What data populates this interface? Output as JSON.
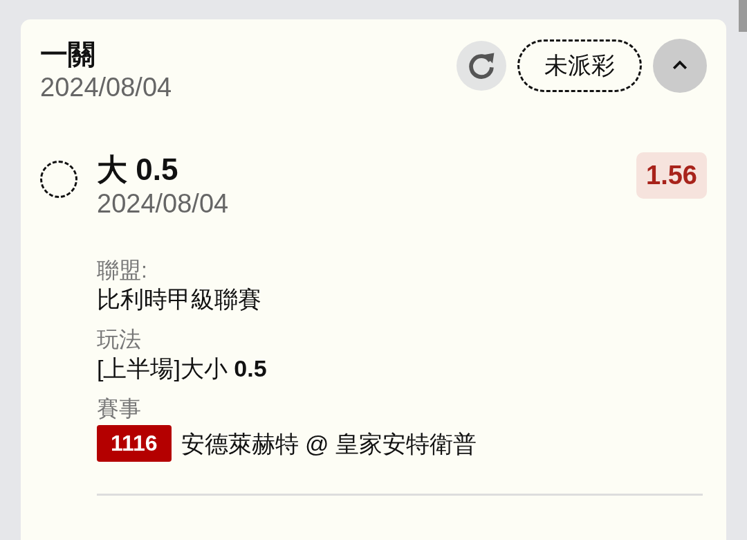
{
  "bet": {
    "type": "一關",
    "date": "2024/08/04",
    "status": "未派彩",
    "expanded": true
  },
  "selections": [
    {
      "name": "大 0.5",
      "date": "2024/08/04",
      "odds": "1.56",
      "selected": false,
      "details": [
        {
          "kind": "text",
          "label": "聯盟:",
          "value": "比利時甲級聯賽"
        },
        {
          "kind": "text",
          "label": "玩法",
          "value": "[上半場]大小 **0.5**"
        },
        {
          "kind": "match",
          "label": "賽事",
          "number": "1116",
          "value": "安德萊赫特 @ 皇家安特衛普"
        }
      ]
    }
  ]
}
